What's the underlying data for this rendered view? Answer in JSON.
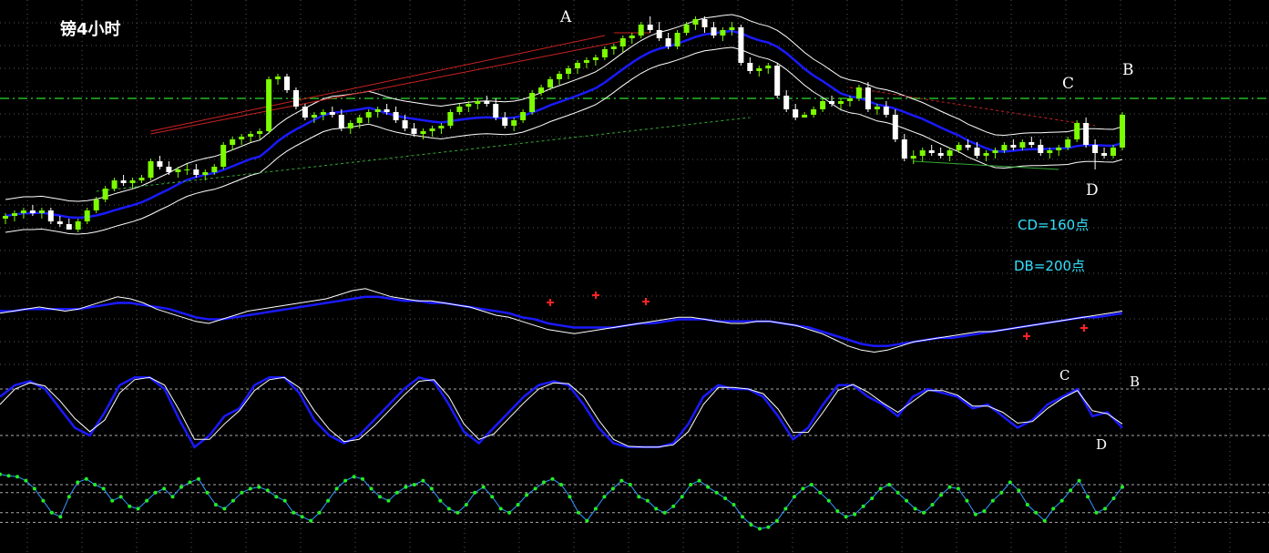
{
  "title": "镑4小时",
  "annotations": {
    "A": "A",
    "B": "B",
    "C": "C",
    "D": "D",
    "osc_C": "C",
    "osc_B": "B",
    "osc_D": "D",
    "cd": "CD=160点",
    "db": "DB=200点"
  },
  "colors": {
    "background": "#000000",
    "bull_candle": "#7CFC00",
    "bear_candle": "#ffffff",
    "ma": "#1a1aff",
    "envelope": "#ffffff",
    "trendline": "#cc2222",
    "support": "#33aa33",
    "level": "#22bb22",
    "osc_fast": "#ffffff",
    "osc_slow": "#1a1aff",
    "dots": "#22ee22",
    "dot_line": "#3399ff",
    "marker": "#ff2222"
  },
  "chart_data": [
    {
      "type": "candlestick",
      "title": "镑4小时",
      "ohlc": [
        [
          40,
          42,
          38,
          41
        ],
        [
          41,
          43,
          39,
          42
        ],
        [
          42,
          44,
          40,
          43
        ],
        [
          43,
          45,
          41,
          42
        ],
        [
          42,
          44,
          40,
          43
        ],
        [
          43,
          44,
          38,
          39
        ],
        [
          39,
          41,
          37,
          38
        ],
        [
          38,
          40,
          36,
          36
        ],
        [
          36,
          40,
          35,
          39
        ],
        [
          39,
          44,
          38,
          43
        ],
        [
          43,
          48,
          42,
          47
        ],
        [
          47,
          52,
          46,
          51
        ],
        [
          51,
          55,
          50,
          54
        ],
        [
          54,
          56,
          52,
          53
        ],
        [
          53,
          55,
          51,
          54
        ],
        [
          54,
          56,
          53,
          55
        ],
        [
          55,
          62,
          54,
          61
        ],
        [
          61,
          63,
          58,
          59
        ],
        [
          59,
          61,
          56,
          57
        ],
        [
          57,
          59,
          55,
          58
        ],
        [
          58,
          60,
          56,
          58
        ],
        [
          58,
          60,
          55,
          56
        ],
        [
          56,
          58,
          54,
          57
        ],
        [
          57,
          60,
          56,
          59
        ],
        [
          59,
          68,
          58,
          67
        ],
        [
          67,
          70,
          65,
          69
        ],
        [
          69,
          71,
          67,
          70
        ],
        [
          70,
          72,
          68,
          71
        ],
        [
          71,
          73,
          69,
          72
        ],
        [
          72,
          92,
          71,
          91
        ],
        [
          91,
          93,
          89,
          92
        ],
        [
          92,
          93,
          86,
          87
        ],
        [
          87,
          88,
          80,
          81
        ],
        [
          81,
          82,
          76,
          77
        ],
        [
          77,
          79,
          75,
          78
        ],
        [
          78,
          80,
          76,
          79
        ],
        [
          79,
          81,
          77,
          78
        ],
        [
          78,
          80,
          72,
          73
        ],
        [
          73,
          76,
          71,
          75
        ],
        [
          75,
          78,
          73,
          77
        ],
        [
          77,
          80,
          75,
          79
        ],
        [
          79,
          81,
          77,
          80
        ],
        [
          80,
          82,
          78,
          79
        ],
        [
          79,
          81,
          75,
          76
        ],
        [
          76,
          78,
          72,
          73
        ],
        [
          73,
          75,
          70,
          71
        ],
        [
          71,
          73,
          69,
          72
        ],
        [
          72,
          74,
          70,
          73
        ],
        [
          73,
          75,
          71,
          74
        ],
        [
          74,
          80,
          73,
          79
        ],
        [
          79,
          82,
          78,
          81
        ],
        [
          81,
          83,
          79,
          82
        ],
        [
          82,
          84,
          80,
          83
        ],
        [
          83,
          85,
          81,
          82
        ],
        [
          82,
          84,
          76,
          77
        ],
        [
          77,
          79,
          73,
          74
        ],
        [
          74,
          77,
          72,
          76
        ],
        [
          76,
          80,
          75,
          79
        ],
        [
          79,
          87,
          78,
          86
        ],
        [
          86,
          89,
          85,
          88
        ],
        [
          88,
          92,
          87,
          91
        ],
        [
          91,
          94,
          89,
          93
        ],
        [
          93,
          96,
          91,
          95
        ],
        [
          95,
          98,
          93,
          97
        ],
        [
          97,
          99,
          95,
          98
        ],
        [
          98,
          100,
          96,
          99
        ],
        [
          99,
          103,
          98,
          102
        ],
        [
          102,
          104,
          100,
          103
        ],
        [
          103,
          107,
          101,
          106
        ],
        [
          106,
          108,
          104,
          107
        ],
        [
          107,
          112,
          106,
          111
        ],
        [
          111,
          114,
          108,
          109
        ],
        [
          109,
          112,
          105,
          106
        ],
        [
          106,
          108,
          102,
          103
        ],
        [
          103,
          109,
          102,
          108
        ],
        [
          108,
          112,
          107,
          111
        ],
        [
          111,
          114,
          109,
          113
        ],
        [
          113,
          114,
          108,
          110
        ],
        [
          110,
          112,
          106,
          107
        ],
        [
          107,
          110,
          105,
          109
        ],
        [
          109,
          112,
          107,
          110
        ],
        [
          110,
          111,
          96,
          97
        ],
        [
          97,
          99,
          93,
          94
        ],
        [
          94,
          96,
          92,
          95
        ],
        [
          95,
          97,
          93,
          96
        ],
        [
          96,
          97,
          84,
          85
        ],
        [
          85,
          87,
          79,
          80
        ],
        [
          80,
          82,
          76,
          77
        ],
        [
          77,
          79,
          77,
          78
        ],
        [
          78,
          81,
          77,
          80
        ],
        [
          80,
          84,
          79,
          83
        ],
        [
          83,
          85,
          81,
          82
        ],
        [
          82,
          84,
          80,
          83
        ],
        [
          83,
          85,
          81,
          84
        ],
        [
          84,
          89,
          83,
          88
        ],
        [
          88,
          90,
          79,
          80
        ],
        [
          80,
          82,
          78,
          81
        ],
        [
          81,
          83,
          77,
          78
        ],
        [
          78,
          80,
          68,
          69
        ],
        [
          69,
          71,
          61,
          62
        ],
        [
          62,
          65,
          60,
          63
        ],
        [
          63,
          66,
          61,
          65
        ],
        [
          65,
          67,
          63,
          64
        ],
        [
          64,
          66,
          62,
          63
        ],
        [
          63,
          66,
          61,
          65
        ],
        [
          65,
          68,
          64,
          67
        ],
        [
          67,
          69,
          65,
          66
        ],
        [
          66,
          68,
          62,
          63
        ],
        [
          63,
          65,
          61,
          64
        ],
        [
          64,
          66,
          62,
          65
        ],
        [
          65,
          68,
          64,
          67
        ],
        [
          67,
          69,
          65,
          66
        ],
        [
          66,
          69,
          65,
          68
        ],
        [
          68,
          70,
          66,
          67
        ],
        [
          67,
          69,
          63,
          64
        ],
        [
          64,
          66,
          62,
          65
        ],
        [
          65,
          67,
          63,
          66
        ],
        [
          66,
          70,
          65,
          69
        ],
        [
          69,
          76,
          68,
          75
        ],
        [
          75,
          77,
          66,
          67
        ],
        [
          67,
          69,
          58,
          64
        ],
        [
          64,
          66,
          62,
          63
        ],
        [
          63,
          67,
          62,
          66
        ],
        [
          66,
          79,
          65,
          78
        ]
      ],
      "levels": {
        "dashed_horizontal": 84
      },
      "labels_at": {
        "A": 107,
        "B": 84,
        "C": 83,
        "D": 58
      }
    },
    {
      "type": "line",
      "series": [
        {
          "values": [
            40,
            41,
            42,
            43,
            42,
            41,
            42,
            44,
            46,
            48,
            47,
            45,
            42,
            40,
            38,
            36,
            35,
            37,
            39,
            41,
            42,
            43,
            44,
            45,
            46,
            47,
            49,
            51,
            52,
            50,
            48,
            47,
            46,
            46,
            45,
            44,
            43,
            41,
            39,
            38,
            36,
            34,
            32,
            31,
            30,
            31,
            32,
            33,
            34,
            35,
            36,
            37,
            38,
            38,
            37,
            36,
            35,
            35,
            36,
            36,
            35,
            34,
            32,
            30,
            27,
            24,
            22,
            21,
            22,
            24,
            26,
            27,
            28,
            29,
            30,
            31,
            31,
            32,
            33,
            34,
            35,
            36,
            37,
            38,
            39,
            40,
            41
          ]
        },
        {
          "values": [
            41,
            41,
            42,
            42,
            42,
            42,
            42,
            43,
            44,
            45,
            45,
            44,
            43,
            42,
            40,
            38,
            37,
            37,
            38,
            39,
            40,
            41,
            42,
            43,
            44,
            45,
            46,
            47,
            48,
            48,
            47,
            46,
            46,
            45,
            45,
            44,
            43,
            42,
            41,
            40,
            38,
            37,
            35,
            34,
            33,
            33,
            33,
            33,
            34,
            35,
            35,
            36,
            37,
            37,
            37,
            36,
            36,
            36,
            36,
            36,
            35,
            34,
            33,
            31,
            29,
            27,
            25,
            24,
            24,
            25,
            26,
            27,
            28,
            28,
            29,
            30,
            31,
            32,
            33,
            34,
            35,
            36,
            37,
            38,
            38,
            39,
            40
          ]
        }
      ]
    },
    {
      "type": "line",
      "ylim": [
        0,
        100
      ],
      "levels": [
        80,
        20
      ],
      "series": [
        {
          "values": [
            70,
            85,
            90,
            80,
            55,
            30,
            20,
            50,
            85,
            95,
            95,
            80,
            40,
            5,
            20,
            45,
            55,
            85,
            95,
            95,
            75,
            40,
            20,
            10,
            20,
            40,
            60,
            80,
            95,
            90,
            60,
            25,
            10,
            30,
            50,
            70,
            85,
            90,
            85,
            60,
            30,
            10,
            5,
            5,
            5,
            10,
            35,
            70,
            85,
            80,
            80,
            70,
            45,
            15,
            30,
            60,
            85,
            85,
            70,
            60,
            45,
            70,
            80,
            75,
            70,
            55,
            60,
            45,
            30,
            40,
            60,
            70,
            80,
            45,
            50,
            30
          ]
        },
        {
          "values": [
            60,
            80,
            88,
            84,
            65,
            42,
            25,
            40,
            75,
            92,
            95,
            85,
            52,
            15,
            15,
            35,
            52,
            78,
            92,
            95,
            82,
            52,
            28,
            12,
            15,
            32,
            52,
            72,
            90,
            92,
            70,
            35,
            15,
            22,
            42,
            62,
            80,
            88,
            87,
            70,
            40,
            15,
            6,
            5,
            5,
            8,
            25,
            60,
            82,
            82,
            80,
            74,
            54,
            24,
            24,
            50,
            78,
            86,
            76,
            62,
            50,
            64,
            78,
            78,
            72,
            58,
            58,
            50,
            36,
            38,
            55,
            68,
            78,
            52,
            48,
            35
          ]
        }
      ],
      "labels_at": {
        "C": 75,
        "B": 80,
        "D": 22
      }
    },
    {
      "type": "line",
      "ylim": [
        0,
        100
      ],
      "levels": [
        75,
        65,
        40,
        28
      ],
      "series": [
        {
          "values": [
            88,
            86,
            85,
            80,
            70,
            55,
            40,
            35,
            60,
            78,
            82,
            75,
            70,
            55,
            60,
            48,
            45,
            55,
            65,
            70,
            60,
            72,
            78,
            82,
            65,
            50,
            45,
            55,
            65,
            70,
            72,
            68,
            60,
            55,
            40,
            35,
            30,
            40,
            55,
            70,
            80,
            85,
            82,
            70,
            60,
            55,
            65,
            72,
            75,
            80,
            70,
            55,
            45,
            40,
            50,
            65,
            72,
            60,
            45,
            40,
            50,
            62,
            70,
            78,
            82,
            75,
            60,
            40,
            30,
            45,
            60,
            70,
            80,
            75,
            60,
            55,
            45,
            40,
            48,
            60,
            75,
            80,
            72,
            65,
            58,
            50,
            35,
            25,
            20,
            22,
            30,
            45,
            60,
            70,
            75,
            65,
            55,
            42,
            35,
            38,
            48,
            58,
            70,
            75,
            65,
            55,
            45,
            40,
            50,
            62,
            72,
            70,
            55,
            38,
            42,
            55,
            65,
            78,
            68,
            50,
            40,
            30,
            45,
            55,
            68,
            80,
            60,
            40,
            45,
            58,
            72
          ]
        }
      ]
    }
  ]
}
